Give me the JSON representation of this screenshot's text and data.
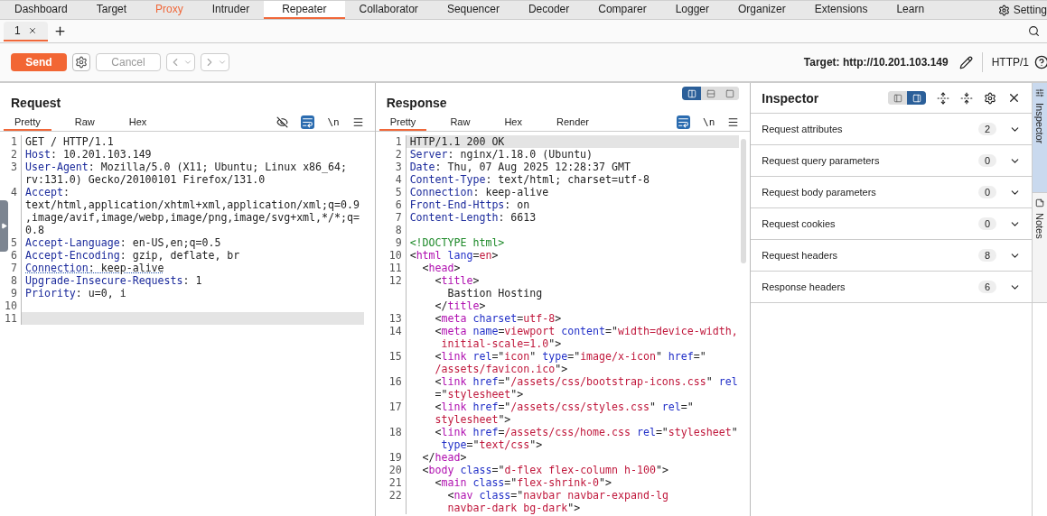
{
  "menu_bar": {
    "tabs": [
      {
        "label": "Dashboard",
        "selected": false,
        "alert": false
      },
      {
        "label": "Target",
        "selected": false,
        "alert": false
      },
      {
        "label": "Proxy",
        "selected": false,
        "alert": true
      },
      {
        "label": "Intruder",
        "selected": false,
        "alert": false
      },
      {
        "label": "Repeater",
        "selected": true,
        "alert": false
      },
      {
        "label": "Collaborator",
        "selected": false,
        "alert": false
      },
      {
        "label": "Sequencer",
        "selected": false,
        "alert": false
      },
      {
        "label": "Decoder",
        "selected": false,
        "alert": false
      },
      {
        "label": "Comparer",
        "selected": false,
        "alert": false
      },
      {
        "label": "Logger",
        "selected": false,
        "alert": false
      },
      {
        "label": "Organizer",
        "selected": false,
        "alert": false
      },
      {
        "label": "Extensions",
        "selected": false,
        "alert": false
      },
      {
        "label": "Learn",
        "selected": false,
        "alert": false
      }
    ],
    "settings": "Setting"
  },
  "repeater_tabs": [
    {
      "label": "1",
      "selected": true
    }
  ],
  "toolbar": {
    "send": "Send",
    "cancel": {
      "label": "Cancel",
      "disabled": true
    },
    "back": {
      "disabled": true
    },
    "forward": {
      "disabled": true
    },
    "target": "Target: http://10.201.103.149",
    "protocol": "HTTP/1"
  },
  "layout_toggle": [
    {
      "selected": true
    },
    {
      "selected": false
    },
    {
      "selected": false
    }
  ],
  "request": {
    "title": "Request",
    "tabs": [
      {
        "label": "Pretty",
        "selected": true
      },
      {
        "label": "Raw",
        "selected": false
      },
      {
        "label": "Hex",
        "selected": false
      }
    ],
    "wrap_on": true,
    "newline_label": "\\n",
    "lines": [
      {
        "number": "1",
        "current": false,
        "rows": [
          {
            "parts": [
              {
                "kind": "text",
                "text": "GET / HTTP/1.1"
              }
            ]
          }
        ]
      },
      {
        "number": "2",
        "current": false,
        "rows": [
          {
            "parts": [
              {
                "kind": "name",
                "text": "Host"
              },
              {
                "kind": "text",
                "text": ": 10.201.103.149"
              }
            ]
          }
        ]
      },
      {
        "number": "3",
        "current": false,
        "rows": [
          {
            "parts": [
              {
                "kind": "name",
                "text": "User-Agent"
              },
              {
                "kind": "text",
                "text": ": Mozilla/5.0 (X11; Ubuntu; Linux x86_64;"
              }
            ]
          },
          {
            "parts": [
              {
                "kind": "text",
                "text": "rv:131.0) Gecko/20100101 Firefox/131.0"
              }
            ]
          }
        ]
      },
      {
        "number": "4",
        "current": false,
        "rows": [
          {
            "parts": [
              {
                "kind": "name",
                "text": "Accept"
              },
              {
                "kind": "text",
                "text": ":"
              }
            ]
          },
          {
            "parts": [
              {
                "kind": "text",
                "text": "text/html,application/xhtml+xml,application/xml;q=0.9"
              }
            ]
          },
          {
            "parts": [
              {
                "kind": "text",
                "text": ",image/avif,image/webp,image/png,image/svg+xml,*/*;q="
              }
            ]
          },
          {
            "parts": [
              {
                "kind": "text",
                "text": "0.8"
              }
            ]
          }
        ]
      },
      {
        "number": "5",
        "current": false,
        "rows": [
          {
            "parts": [
              {
                "kind": "name",
                "text": "Accept-Language"
              },
              {
                "kind": "text",
                "text": ": en-US,en;q=0.5"
              }
            ]
          }
        ]
      },
      {
        "number": "6",
        "current": false,
        "rows": [
          {
            "parts": [
              {
                "kind": "name",
                "text": "Accept-Encoding"
              },
              {
                "kind": "text",
                "text": ": gzip, deflate, br"
              }
            ]
          }
        ]
      },
      {
        "number": "7",
        "current": false,
        "rows": [
          {
            "parts": [
              {
                "kind": "warnname",
                "text": "Connection"
              },
              {
                "kind": "warntext",
                "text": ": keep-alive"
              }
            ]
          }
        ]
      },
      {
        "number": "8",
        "current": false,
        "rows": [
          {
            "parts": [
              {
                "kind": "name",
                "text": "Upgrade-Insecure-Requests"
              },
              {
                "kind": "text",
                "text": ": 1"
              }
            ]
          }
        ]
      },
      {
        "number": "9",
        "current": false,
        "rows": [
          {
            "parts": [
              {
                "kind": "name",
                "text": "Priority"
              },
              {
                "kind": "text",
                "text": ": u=0, i"
              }
            ]
          }
        ]
      },
      {
        "number": "10",
        "current": false,
        "rows": [
          {}
        ]
      },
      {
        "number": "11",
        "current": true,
        "rows": [
          {}
        ]
      }
    ]
  },
  "response": {
    "title": "Response",
    "tabs": [
      {
        "label": "Pretty",
        "selected": true
      },
      {
        "label": "Raw",
        "selected": false
      },
      {
        "label": "Hex",
        "selected": false
      },
      {
        "label": "Render",
        "selected": false
      }
    ],
    "wrap_on": true,
    "newline_label": "\\n",
    "lines": [
      {
        "number": "1",
        "current": true,
        "rows": [
          {
            "parts": [
              {
                "kind": "text",
                "text": "HTTP/1.1 200 OK"
              }
            ]
          }
        ]
      },
      {
        "number": "2",
        "current": false,
        "rows": [
          {
            "parts": [
              {
                "kind": "name",
                "text": "Server"
              },
              {
                "kind": "text",
                "text": ": nginx/1.18.0 (Ubuntu)"
              }
            ]
          }
        ]
      },
      {
        "number": "3",
        "current": false,
        "rows": [
          {
            "parts": [
              {
                "kind": "name",
                "text": "Date"
              },
              {
                "kind": "text",
                "text": ": Thu, 07 Aug 2025 12:28:37 GMT"
              }
            ]
          }
        ]
      },
      {
        "number": "4",
        "current": false,
        "rows": [
          {
            "parts": [
              {
                "kind": "name",
                "text": "Content-Type"
              },
              {
                "kind": "text",
                "text": ": text/html; charset=utf-8"
              }
            ]
          }
        ]
      },
      {
        "number": "5",
        "current": false,
        "rows": [
          {
            "parts": [
              {
                "kind": "name",
                "text": "Connection"
              },
              {
                "kind": "text",
                "text": ": keep-alive"
              }
            ]
          }
        ]
      },
      {
        "number": "6",
        "current": false,
        "rows": [
          {
            "parts": [
              {
                "kind": "name",
                "text": "Front-End-Https"
              },
              {
                "kind": "text",
                "text": ": on"
              }
            ]
          }
        ]
      },
      {
        "number": "7",
        "current": false,
        "rows": [
          {
            "parts": [
              {
                "kind": "name",
                "text": "Content-Length"
              },
              {
                "kind": "text",
                "text": ": 6613"
              }
            ]
          }
        ]
      },
      {
        "number": "8",
        "current": false,
        "rows": [
          {}
        ]
      },
      {
        "number": "9",
        "current": false,
        "rows": [
          {
            "parts": [
              {
                "kind": "doctype",
                "text": "<!DOCTYPE html>"
              }
            ]
          }
        ]
      },
      {
        "number": "10",
        "current": false,
        "rows": [
          {
            "parts": [
              {
                "kind": "text",
                "text": "<"
              },
              {
                "kind": "tag",
                "text": "html"
              },
              {
                "kind": "attr",
                "text": " lang"
              },
              {
                "kind": "text",
                "text": "="
              },
              {
                "kind": "value",
                "text": "en"
              },
              {
                "kind": "text",
                "text": ">"
              }
            ]
          }
        ]
      },
      {
        "number": "11",
        "current": false,
        "rows": [
          {
            "parts": [
              {
                "kind": "text",
                "text": "  <"
              },
              {
                "kind": "tag",
                "text": "head"
              },
              {
                "kind": "text",
                "text": ">"
              }
            ]
          }
        ]
      },
      {
        "number": "12",
        "current": false,
        "rows": [
          {
            "parts": [
              {
                "kind": "text",
                "text": "    <"
              },
              {
                "kind": "tag",
                "text": "title"
              },
              {
                "kind": "text",
                "text": ">"
              }
            ]
          },
          {
            "parts": [
              {
                "kind": "text",
                "text": "      Bastion Hosting"
              }
            ]
          },
          {
            "parts": [
              {
                "kind": "text",
                "text": "    </"
              },
              {
                "kind": "tag",
                "text": "title"
              },
              {
                "kind": "text",
                "text": ">"
              }
            ]
          }
        ]
      },
      {
        "number": "13",
        "current": false,
        "rows": [
          {
            "parts": [
              {
                "kind": "text",
                "text": "    <"
              },
              {
                "kind": "tag",
                "text": "meta"
              },
              {
                "kind": "attr",
                "text": " charset"
              },
              {
                "kind": "text",
                "text": "="
              },
              {
                "kind": "value",
                "text": "utf-8"
              },
              {
                "kind": "text",
                "text": ">"
              }
            ]
          }
        ]
      },
      {
        "number": "14",
        "current": false,
        "rows": [
          {
            "parts": [
              {
                "kind": "text",
                "text": "    <"
              },
              {
                "kind": "tag",
                "text": "meta"
              },
              {
                "kind": "attr",
                "text": " name"
              },
              {
                "kind": "text",
                "text": "="
              },
              {
                "kind": "value",
                "text": "viewport"
              },
              {
                "kind": "attr",
                "text": " content"
              },
              {
                "kind": "text",
                "text": "=\""
              },
              {
                "kind": "value",
                "text": "width=device-width,"
              }
            ]
          },
          {
            "parts": [
              {
                "kind": "value",
                "text": "     initial-scale=1.0"
              },
              {
                "kind": "text",
                "text": "\">"
              }
            ]
          }
        ]
      },
      {
        "number": "15",
        "current": false,
        "rows": [
          {
            "parts": [
              {
                "kind": "text",
                "text": "    <"
              },
              {
                "kind": "tag",
                "text": "link"
              },
              {
                "kind": "attr",
                "text": " rel"
              },
              {
                "kind": "text",
                "text": "=\""
              },
              {
                "kind": "value",
                "text": "icon"
              },
              {
                "kind": "text",
                "text": "\""
              },
              {
                "kind": "attr",
                "text": " type"
              },
              {
                "kind": "text",
                "text": "=\""
              },
              {
                "kind": "value",
                "text": "image/x-icon"
              },
              {
                "kind": "text",
                "text": "\""
              },
              {
                "kind": "attr",
                "text": " href"
              },
              {
                "kind": "text",
                "text": "=\""
              }
            ]
          },
          {
            "parts": [
              {
                "kind": "value",
                "text": "    /assets/favicon.ico"
              },
              {
                "kind": "text",
                "text": "\">"
              }
            ]
          }
        ]
      },
      {
        "number": "16",
        "current": false,
        "rows": [
          {
            "parts": [
              {
                "kind": "text",
                "text": "    <"
              },
              {
                "kind": "tag",
                "text": "link"
              },
              {
                "kind": "attr",
                "text": " href"
              },
              {
                "kind": "text",
                "text": "=\""
              },
              {
                "kind": "value",
                "text": "/assets/css/bootstrap-icons.css"
              },
              {
                "kind": "text",
                "text": "\""
              },
              {
                "kind": "attr",
                "text": " rel"
              }
            ]
          },
          {
            "parts": [
              {
                "kind": "text",
                "text": "    =\""
              },
              {
                "kind": "value",
                "text": "stylesheet"
              },
              {
                "kind": "text",
                "text": "\">"
              }
            ]
          }
        ]
      },
      {
        "number": "17",
        "current": false,
        "rows": [
          {
            "parts": [
              {
                "kind": "text",
                "text": "    <"
              },
              {
                "kind": "tag",
                "text": "link"
              },
              {
                "kind": "attr",
                "text": " href"
              },
              {
                "kind": "text",
                "text": "=\""
              },
              {
                "kind": "value",
                "text": "/assets/css/styles.css"
              },
              {
                "kind": "text",
                "text": "\""
              },
              {
                "kind": "attr",
                "text": " rel"
              },
              {
                "kind": "text",
                "text": "=\""
              }
            ]
          },
          {
            "parts": [
              {
                "kind": "value",
                "text": "    stylesheet"
              },
              {
                "kind": "text",
                "text": "\">"
              }
            ]
          }
        ]
      },
      {
        "number": "18",
        "current": false,
        "rows": [
          {
            "parts": [
              {
                "kind": "text",
                "text": "    <"
              },
              {
                "kind": "tag",
                "text": "link"
              },
              {
                "kind": "attr",
                "text": " href"
              },
              {
                "kind": "text",
                "text": "="
              },
              {
                "kind": "value",
                "text": "/assets/css/home.css"
              },
              {
                "kind": "attr",
                "text": " rel"
              },
              {
                "kind": "text",
                "text": "=\""
              },
              {
                "kind": "value",
                "text": "stylesheet"
              },
              {
                "kind": "text",
                "text": "\""
              }
            ]
          },
          {
            "parts": [
              {
                "kind": "attr",
                "text": "     type"
              },
              {
                "kind": "text",
                "text": "=\""
              },
              {
                "kind": "value",
                "text": "text/css"
              },
              {
                "kind": "text",
                "text": "\">"
              }
            ]
          }
        ]
      },
      {
        "number": "19",
        "current": false,
        "rows": [
          {
            "parts": [
              {
                "kind": "text",
                "text": "  </"
              },
              {
                "kind": "tag",
                "text": "head"
              },
              {
                "kind": "text",
                "text": ">"
              }
            ]
          }
        ]
      },
      {
        "number": "20",
        "current": false,
        "rows": [
          {
            "parts": [
              {
                "kind": "text",
                "text": "  <"
              },
              {
                "kind": "tag",
                "text": "body"
              },
              {
                "kind": "attr",
                "text": " class"
              },
              {
                "kind": "text",
                "text": "=\""
              },
              {
                "kind": "value",
                "text": "d-flex flex-column h-100"
              },
              {
                "kind": "text",
                "text": "\">"
              }
            ]
          }
        ]
      },
      {
        "number": "21",
        "current": false,
        "rows": [
          {
            "parts": [
              {
                "kind": "text",
                "text": "    <"
              },
              {
                "kind": "tag",
                "text": "main"
              },
              {
                "kind": "attr",
                "text": " class"
              },
              {
                "kind": "text",
                "text": "=\""
              },
              {
                "kind": "value",
                "text": "flex-shrink-0"
              },
              {
                "kind": "text",
                "text": "\">"
              }
            ]
          }
        ]
      },
      {
        "number": "22",
        "current": false,
        "rows": [
          {
            "parts": [
              {
                "kind": "text",
                "text": "      <"
              },
              {
                "kind": "tag",
                "text": "nav"
              },
              {
                "kind": "attr",
                "text": " class"
              },
              {
                "kind": "text",
                "text": "=\""
              },
              {
                "kind": "value",
                "text": "navbar navbar-expand-lg"
              }
            ]
          },
          {
            "parts": [
              {
                "kind": "value",
                "text": "      navbar-dark bg-dark"
              },
              {
                "kind": "text",
                "text": "\">"
              }
            ]
          }
        ]
      }
    ]
  },
  "inspector": {
    "title": "Inspector",
    "view_toggle": [
      {
        "selected": false
      },
      {
        "selected": true
      }
    ],
    "sections": [
      {
        "label": "Request attributes",
        "count": "2"
      },
      {
        "label": "Request query parameters",
        "count": "0"
      },
      {
        "label": "Request body parameters",
        "count": "0"
      },
      {
        "label": "Request cookies",
        "count": "0"
      },
      {
        "label": "Request headers",
        "count": "8"
      },
      {
        "label": "Response headers",
        "count": "6"
      }
    ]
  },
  "side_tabs": [
    {
      "label": "Inspector",
      "selected": true
    },
    {
      "label": "Notes",
      "selected": false
    }
  ]
}
